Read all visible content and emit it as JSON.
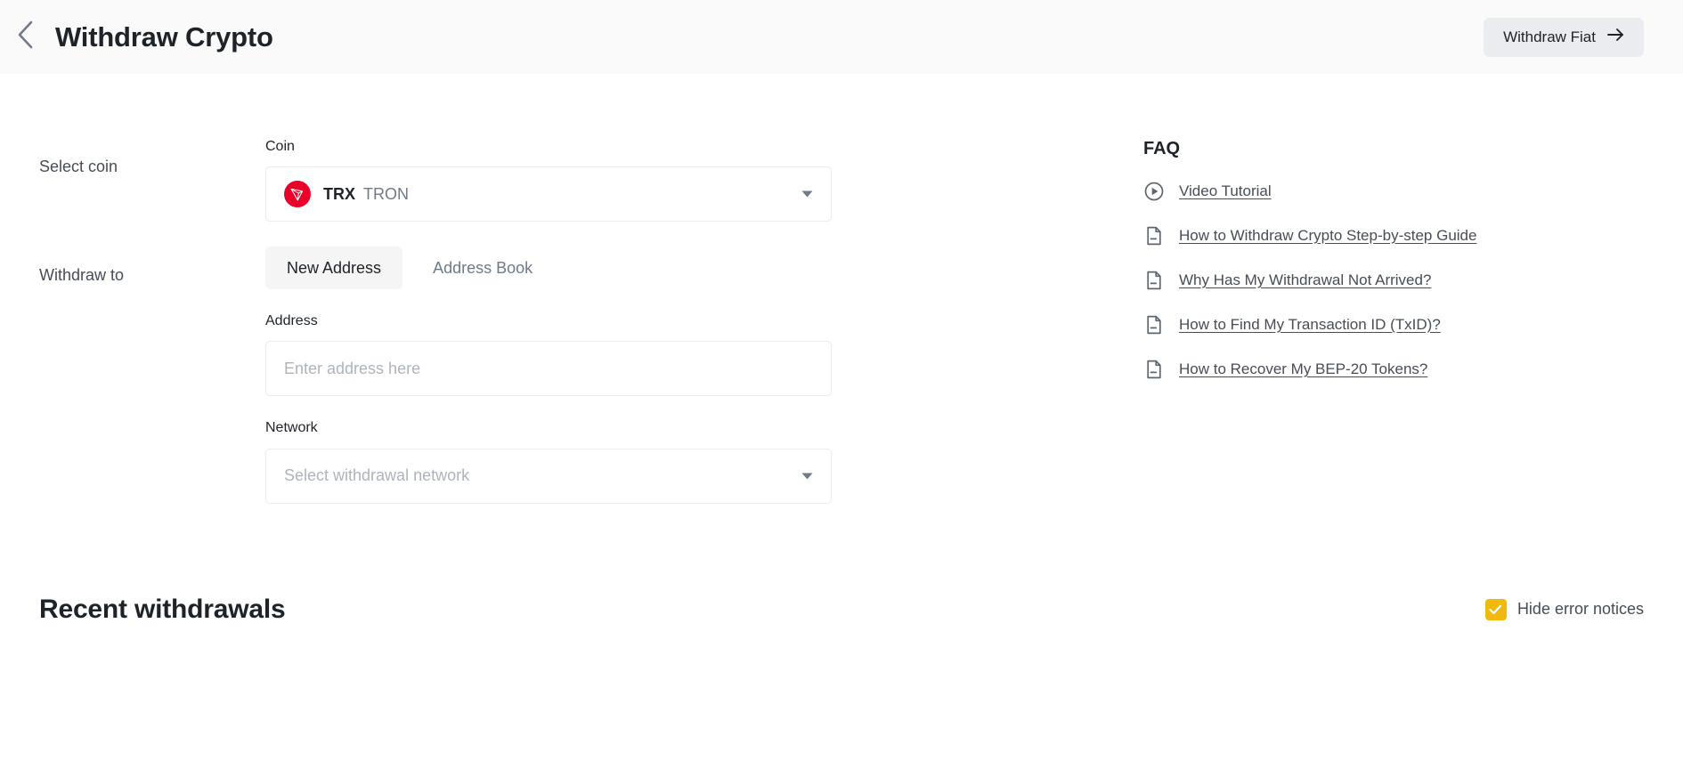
{
  "header": {
    "back_icon": "chevron-left-icon",
    "title": "Withdraw Crypto",
    "withdraw_fiat_label": "Withdraw Fiat",
    "withdraw_fiat_icon": "arrow-right-icon"
  },
  "form": {
    "select_coin_label": "Select coin",
    "coin_field_label": "Coin",
    "coin": {
      "icon": "trx-coin-icon",
      "symbol": "TRX",
      "name": "TRON",
      "icon_color": "#eb0029"
    },
    "withdraw_to_label": "Withdraw to",
    "tabs": [
      {
        "label": "New Address",
        "active": true
      },
      {
        "label": "Address Book",
        "active": false
      }
    ],
    "address_field_label": "Address",
    "address_value": "",
    "address_placeholder": "Enter address here",
    "network_field_label": "Network",
    "network_value": "",
    "network_placeholder": "Select withdrawal network"
  },
  "faq": {
    "title": "FAQ",
    "items": [
      {
        "label": "Video Tutorial",
        "icon": "play-circle-icon"
      },
      {
        "label": "How to Withdraw Crypto Step-by-step Guide",
        "icon": "document-icon"
      },
      {
        "label": "Why Has My Withdrawal Not Arrived?",
        "icon": "document-icon"
      },
      {
        "label": "How to Find My Transaction ID (TxID)?",
        "icon": "document-icon"
      },
      {
        "label": "How to Recover My BEP-20 Tokens?",
        "icon": "document-icon"
      }
    ]
  },
  "recent": {
    "title": "Recent withdrawals",
    "hide_errors_label": "Hide error notices",
    "hide_errors_checked": true,
    "checkbox_color": "#f0b90b"
  }
}
